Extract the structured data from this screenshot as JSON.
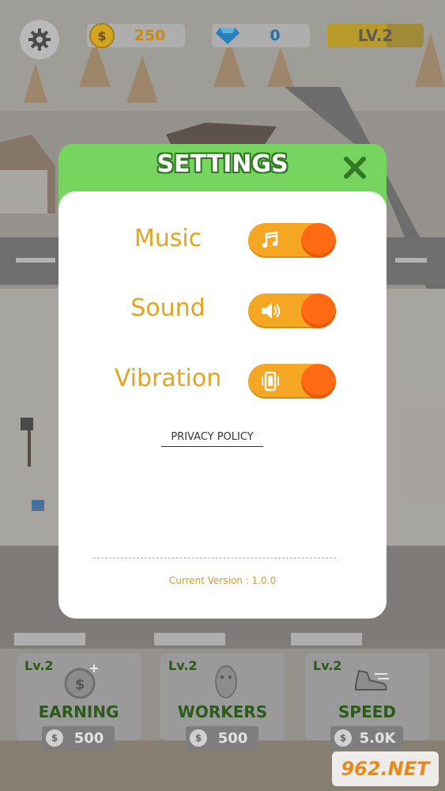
{
  "hud": {
    "coins": "250",
    "gems": "0",
    "level": "LV.2"
  },
  "settings": {
    "title": "SETTINGS",
    "rows": [
      {
        "label": "Music",
        "icon": "music-note-icon",
        "on": true
      },
      {
        "label": "Sound",
        "icon": "speaker-icon",
        "on": true
      },
      {
        "label": "Vibration",
        "icon": "vibration-icon",
        "on": true
      }
    ],
    "privacy_link": "PRIVACY POLICY",
    "version": "Current Version : 1.0.0"
  },
  "cards": [
    {
      "level": "Lv.2",
      "name": "EARNING",
      "cost": "500",
      "icon": "coin-plus-icon"
    },
    {
      "level": "Lv.2",
      "name": "WORKERS",
      "cost": "500",
      "icon": "worker-icon"
    },
    {
      "level": "Lv.2",
      "name": "SPEED",
      "cost": "5.0K",
      "icon": "shoe-icon"
    }
  ],
  "watermark": "962.NET",
  "colors": {
    "header_green": "#76d45f",
    "label_orange": "#e4a41f",
    "toggle_track": "#f5a623",
    "toggle_knob": "#ff6a13"
  }
}
